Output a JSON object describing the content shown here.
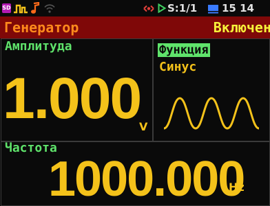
{
  "status_bar": {
    "sd_label": "SD",
    "icons": [
      "sd-card-icon",
      "pulse-icon",
      "music-note-icon",
      "wifi-icon",
      "link-icon",
      "play-icon",
      "pc-icon"
    ],
    "play_status": "S:1/1",
    "battery_or_time": "15 14"
  },
  "header": {
    "title": "Генератор",
    "state": "Включен"
  },
  "amplitude": {
    "label": "Амплитуда",
    "value": "1.000",
    "unit": "V"
  },
  "function": {
    "label": "Функция",
    "value": "Синус",
    "waveform_icon": "sine-wave-icon"
  },
  "frequency": {
    "label": "Частота",
    "value": "1000.000",
    "unit": "Hz"
  },
  "colors": {
    "background": "#0a0a0a",
    "header_bg": "#7f0808",
    "title": "#ff8a1c",
    "state": "#f7f23a",
    "label": "#5fe36b",
    "value": "#f4c21a"
  }
}
